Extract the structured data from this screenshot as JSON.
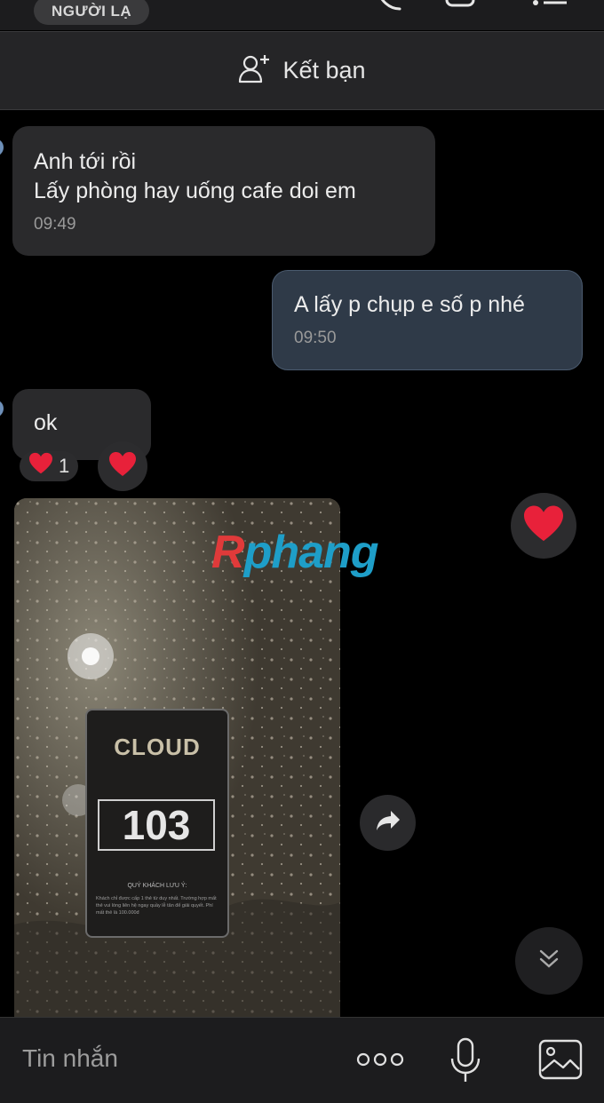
{
  "header": {
    "stranger_badge": "NGƯỜI LẠ",
    "icons": [
      "phone-icon",
      "video-call-icon",
      "menu-icon"
    ]
  },
  "add_friend": {
    "label": "Kết bạn",
    "icon": "add-user-icon"
  },
  "messages": [
    {
      "direction": "incoming",
      "text": "Anh tới rồi\nLấy phòng hay uống cafe doi em",
      "time": "09:49"
    },
    {
      "direction": "outgoing",
      "text": "A lấy p chụp e số p nhé",
      "time": "09:50"
    },
    {
      "direction": "incoming",
      "text": "ok",
      "reaction_count": "1",
      "reaction_emoji": "heart"
    },
    {
      "direction": "incoming",
      "type": "image",
      "photo": {
        "card_brand": "CLOUD",
        "room_number": "103",
        "note_title": "QUÝ KHÁCH LƯU Ý:",
        "note_text": "Khách chỉ được cấp 1 thẻ từ duy nhất. Trường hợp mất thẻ vui lòng liên hệ ngay quầy lễ tân để giải quyết. Phí mất thẻ là 100.000đ"
      },
      "watermark": {
        "first": "R",
        "rest": "phang"
      }
    }
  ],
  "actions": {
    "forward_icon": "forward-icon",
    "scroll_down_icon": "chevron-double-down-icon",
    "quick_reaction_icon": "heart-icon"
  },
  "input": {
    "placeholder": "Tin nhắn",
    "icons": [
      "more-icon",
      "microphone-icon",
      "image-icon"
    ]
  },
  "colors": {
    "background": "#000000",
    "incoming_bubble": "#2a2a2c",
    "outgoing_bubble": "#2f3a48",
    "heart": "#e8213a"
  }
}
